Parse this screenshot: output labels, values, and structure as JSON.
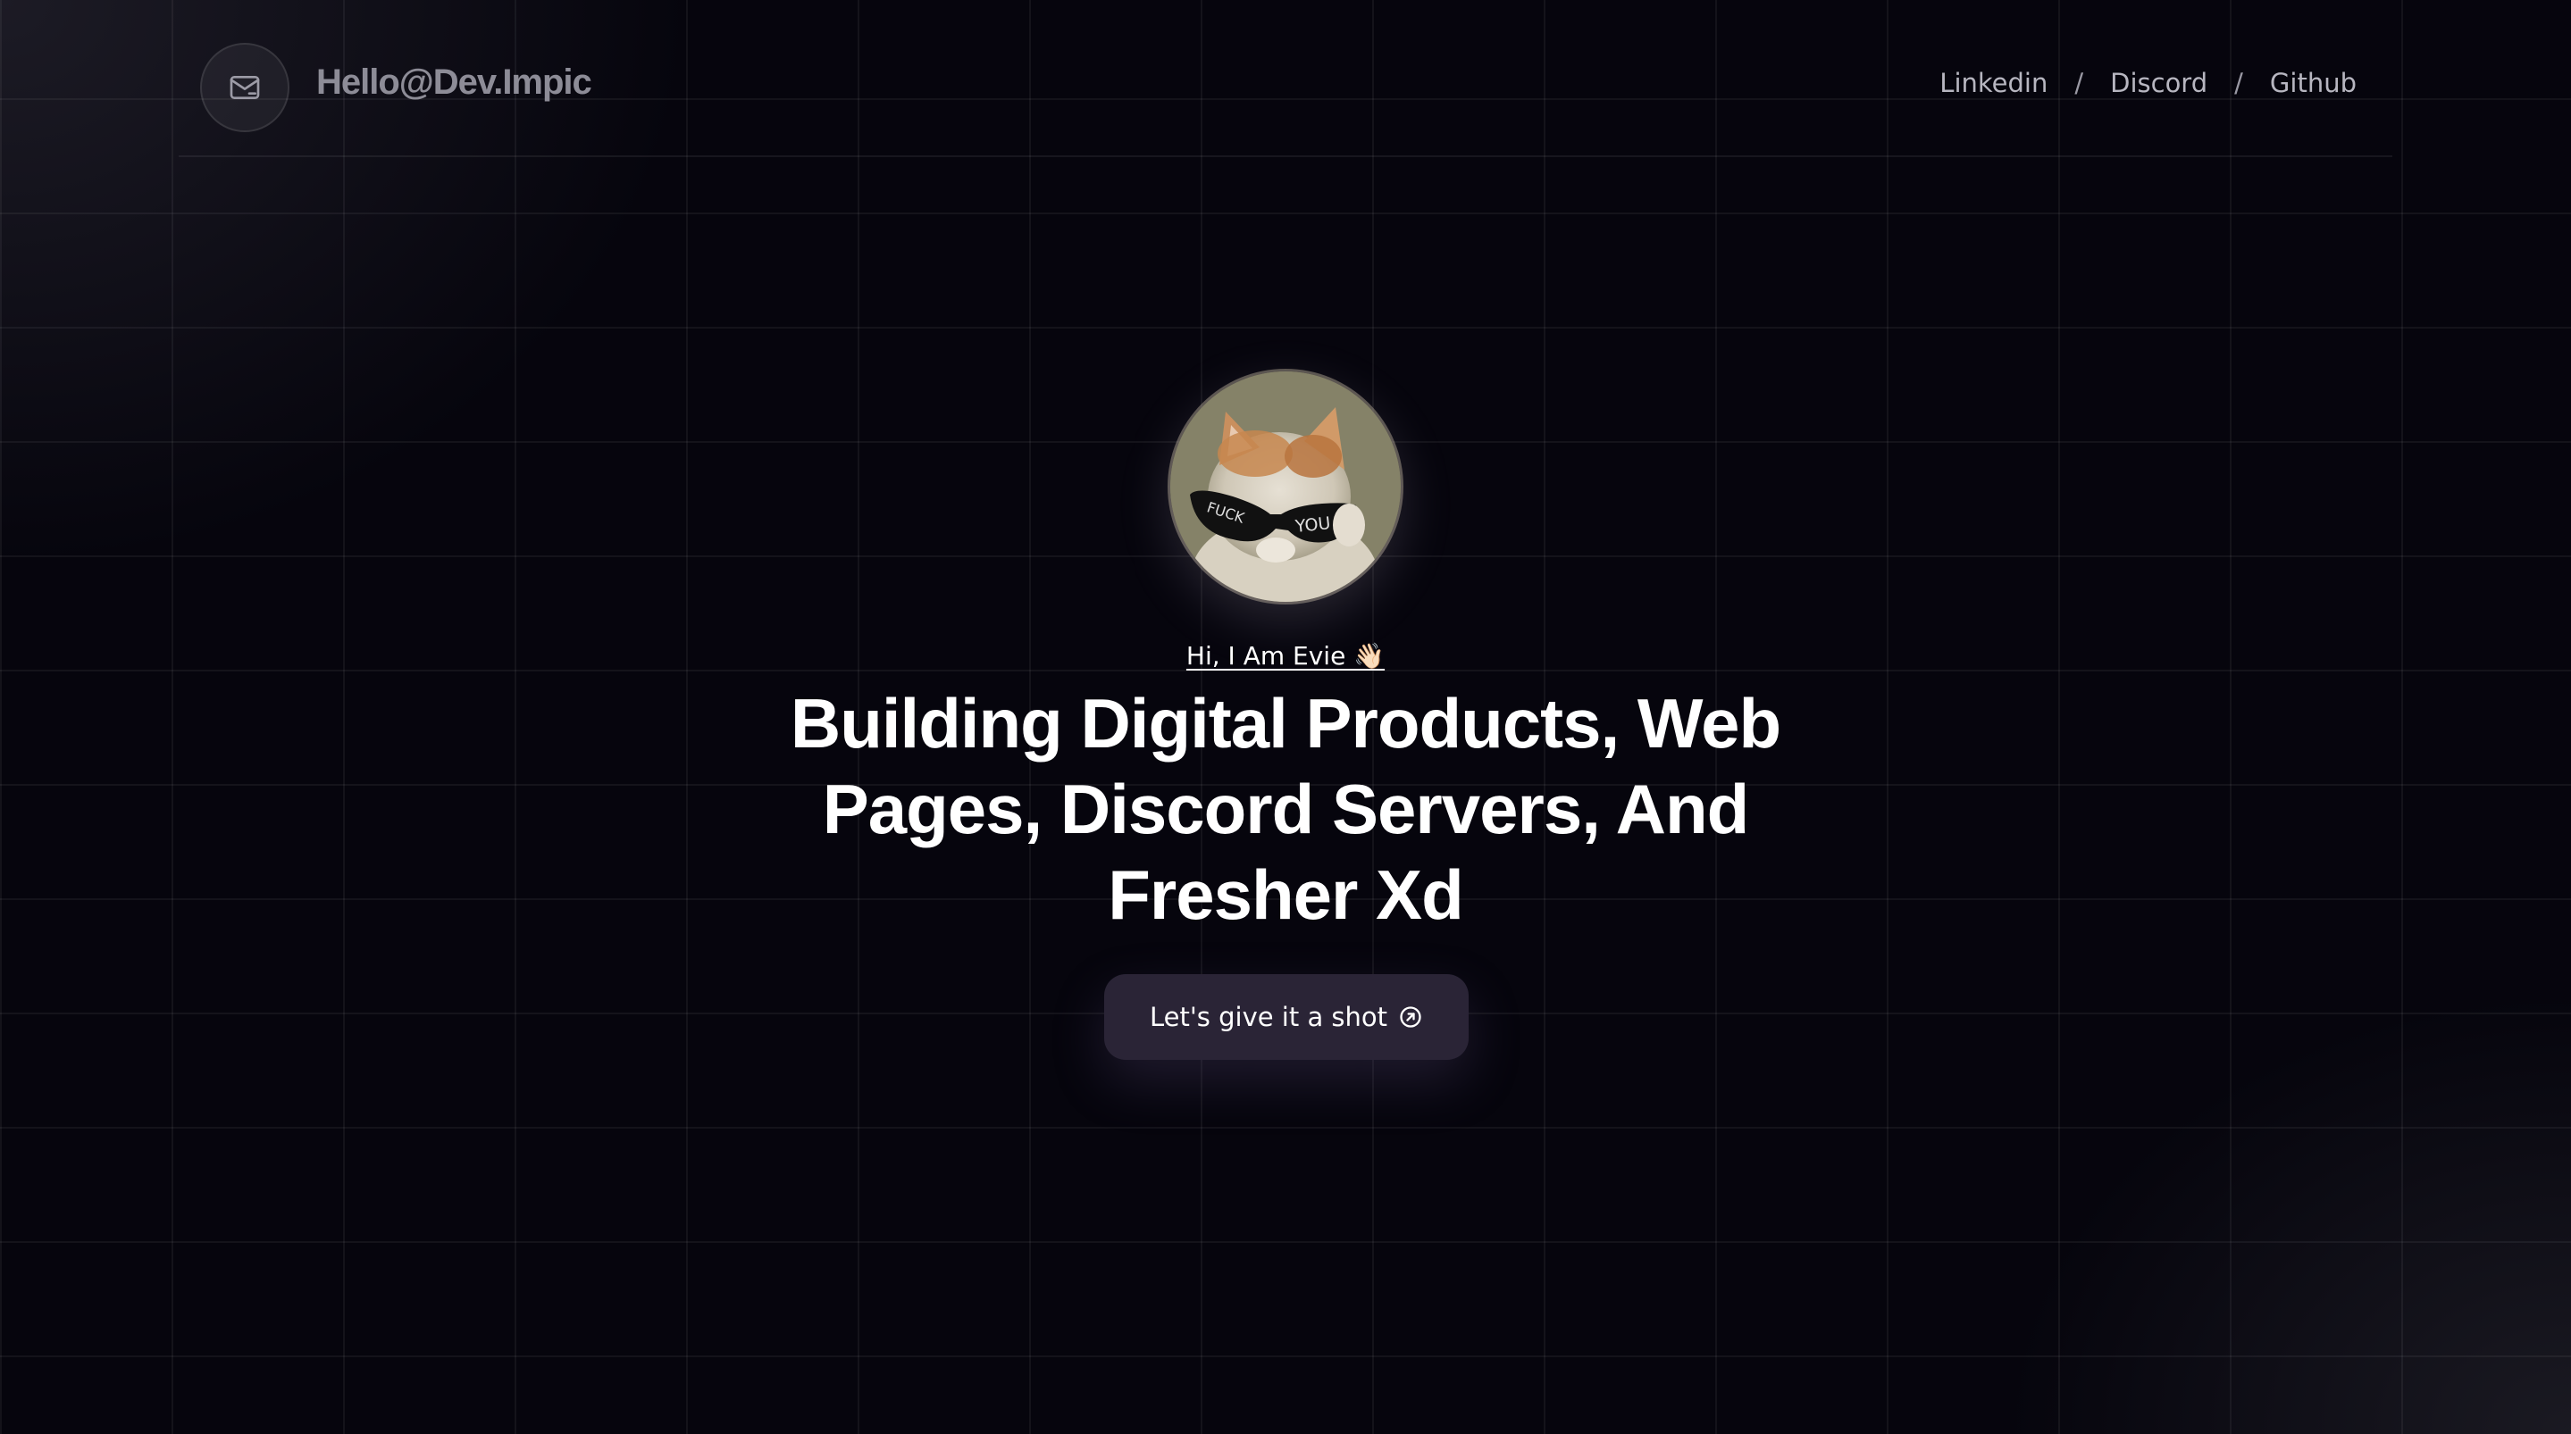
{
  "header": {
    "brand": "Hello@Dev.Impic",
    "nav": [
      {
        "label": "Linkedin"
      },
      {
        "label": "Discord"
      },
      {
        "label": "Github"
      }
    ],
    "separator": "/"
  },
  "hero": {
    "avatar_icon": "cat-with-sunglasses-avatar",
    "avatar_text_left": "FUCK",
    "avatar_text_right": "YOU",
    "greeting": "Hi, I Am Evie 👋🏻",
    "headline": "Building Digital Products, Web Pages, Discord Servers, And Fresher Xd",
    "cta_label": "Let's give it a shot",
    "cta_icon": "arrow-up-right-circle-icon"
  },
  "colors": {
    "background": "#06050d",
    "cta_background": "#2a2436",
    "brand_text": "#8d8c97",
    "nav_text": "#b7b6c0"
  }
}
